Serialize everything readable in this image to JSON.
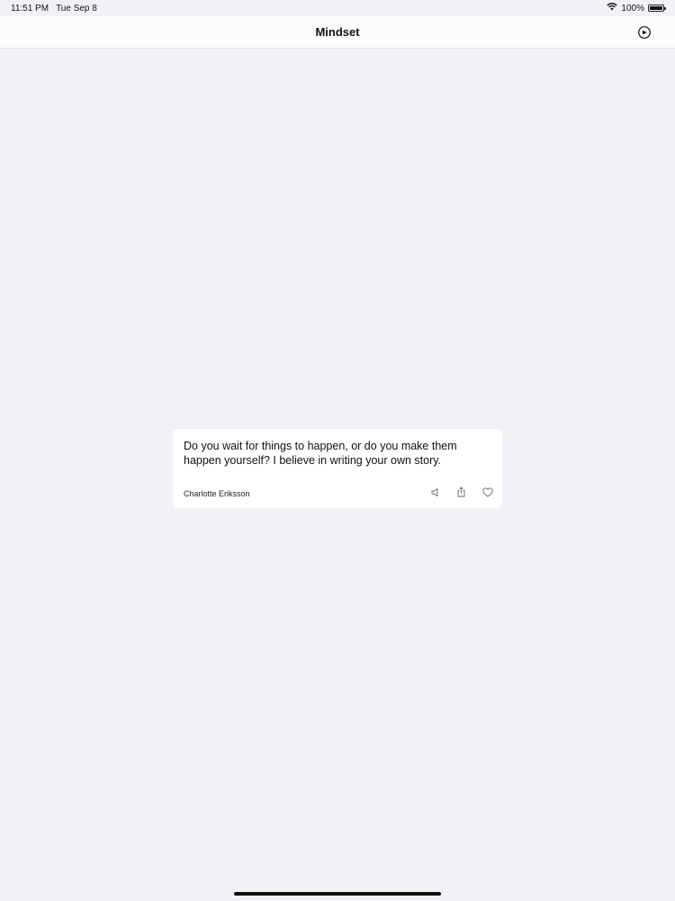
{
  "status_bar": {
    "time": "11:51 PM",
    "date": "Tue Sep 8",
    "battery_percent": "100%",
    "battery_level": 1.0
  },
  "nav": {
    "title": "Mindset",
    "settings_icon": "gear-badge-icon"
  },
  "quote": {
    "text": "Do you wait for things to happen, or do you make them happen yourself? I believe in writing your own story.",
    "author": "Charlotte Eriksson",
    "actions": [
      "speaker-icon",
      "share-icon",
      "heart-icon"
    ]
  }
}
